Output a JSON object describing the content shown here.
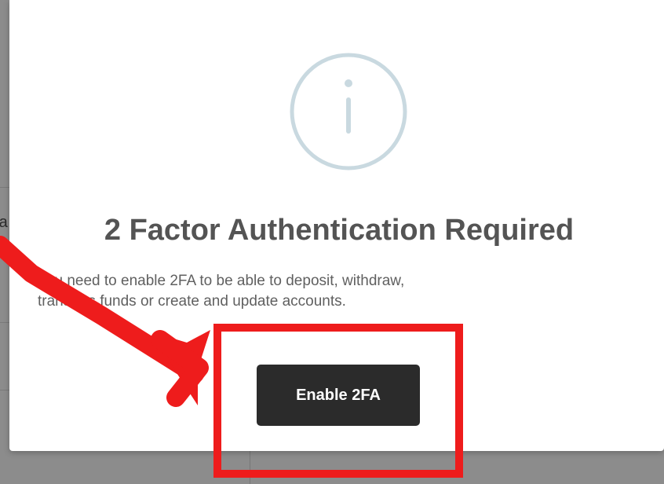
{
  "background": {
    "partial_text": "ra"
  },
  "modal": {
    "icon": "info-icon",
    "icon_color": "#c9d9e0",
    "title": "2 Factor Authentication Required",
    "message_line1": "You need to enable 2FA to be able to deposit, withdraw,",
    "message_line2": "transfers funds or create and update accounts.",
    "button_label": "Enable 2FA"
  },
  "annotation": {
    "color": "#ee1c1c",
    "shapes": [
      "red-arrow",
      "red-highlight-box"
    ]
  }
}
